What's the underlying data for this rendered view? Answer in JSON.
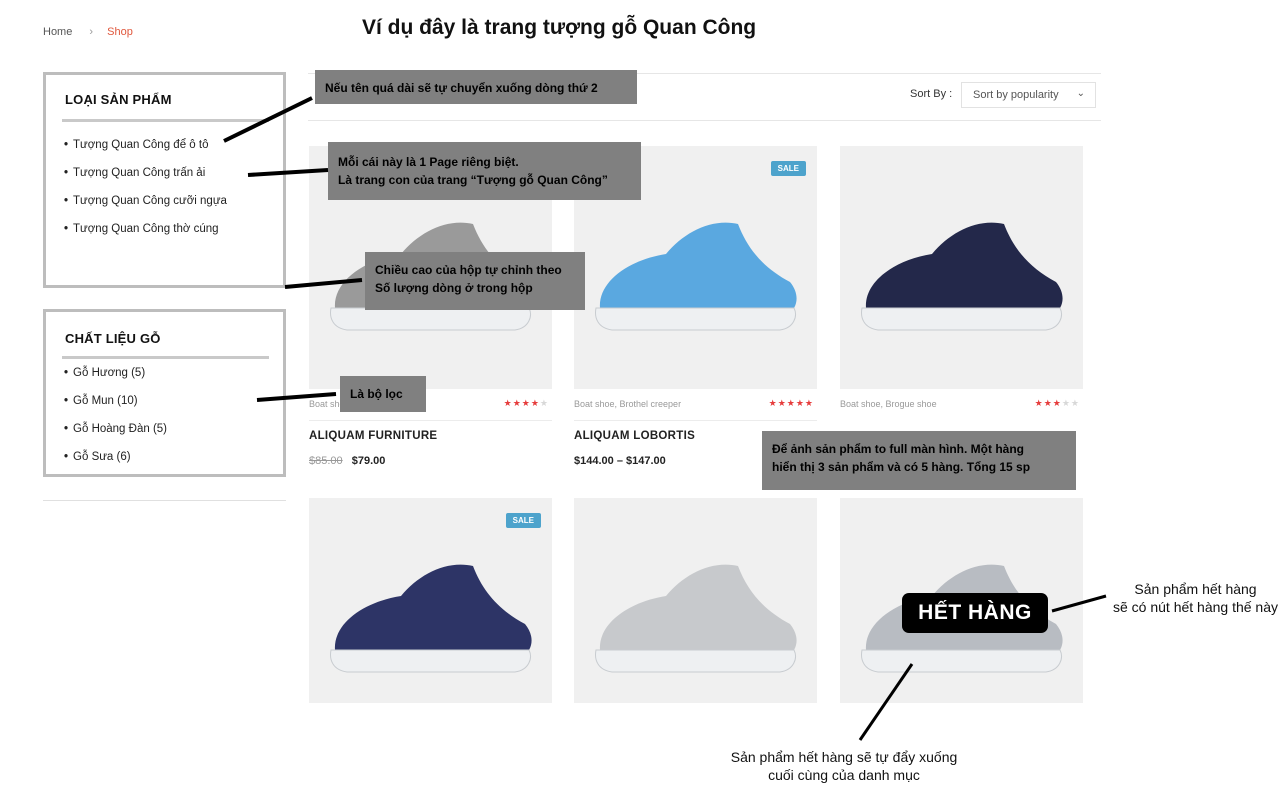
{
  "breadcrumb": {
    "home": "Home",
    "separator": "›",
    "current": "Shop"
  },
  "heading": "Ví dụ đây là trang tượng gỗ Quan Công",
  "sidebar": {
    "categories": {
      "title": "LOẠI SẢN PHẨM",
      "items": [
        "Tượng Quan Công để ô tô",
        "Tượng Quan Công trấn ải",
        "Tượng Quan Công cưỡi ngựa",
        "Tượng Quan Công thờ cúng"
      ]
    },
    "materials": {
      "title": "CHẤT LIỆU GỖ",
      "items": [
        "Gỗ Hương (5)",
        "Gỗ Mun (10)",
        "Gỗ Hoàng Đàn (5)",
        "Gỗ Sưa (6)"
      ]
    }
  },
  "toolbar": {
    "sort_label": "Sort By :",
    "sort_value": "Sort by popularity",
    "chevron_icon": "chevron-down-icon"
  },
  "products": [
    {
      "categories": "Boat shoe,",
      "rating": 4,
      "name": "ALIQUAM FURNITURE",
      "old_price": "$85.00",
      "price": "$79.00",
      "sale": "",
      "shoe_color": "#9a9a9a"
    },
    {
      "categories": "Boat shoe, Brothel creeper",
      "rating": 5,
      "name": "ALIQUAM LOBORTIS",
      "old_price": "",
      "price": "$144.00 – $147.00",
      "sale": "SALE",
      "shoe_color": "#5aa8e0"
    },
    {
      "categories": "Boat shoe, Brogue shoe",
      "rating": 3,
      "name": "",
      "old_price": "",
      "price": "",
      "sale": "",
      "shoe_color": "#23284a"
    },
    {
      "categories": "",
      "rating": 0,
      "name": "",
      "old_price": "",
      "price": "",
      "sale": "SALE",
      "shoe_color": "#2d3466"
    },
    {
      "categories": "",
      "rating": 0,
      "name": "",
      "old_price": "",
      "price": "",
      "sale": "",
      "shoe_color": "#c7c9cc"
    },
    {
      "categories": "",
      "rating": 0,
      "name": "",
      "old_price": "",
      "price": "",
      "sale": "",
      "shoe_color": "#b8bcc2"
    }
  ],
  "out_of_stock_label": "HẾT HÀNG",
  "annotations": {
    "note1": "Nếu tên quá dài sẽ tự chuyển xuống dòng thứ 2",
    "note2_line1": "Mỗi cái này là 1 Page riêng biệt.",
    "note2_line2": "Là trang con của trang “Tượng gỗ Quan Công”",
    "note3_line1": "Chiều cao của hộp tự chỉnh theo",
    "note3_line2": "Số lượng dòng ở trong hộp",
    "note4": "Là bộ lọc",
    "note5_line1": "Để ảnh sản phẩm to full màn hình. Một hàng",
    "note5_line2": "hiển thị 3 sản phẩm và có 5 hàng. Tổng 15 sp",
    "oos_note_line1": "Sản phẩm hết hàng",
    "oos_note_line2": "sẽ có nút hết hàng thế này",
    "bottom_note_line1": "Sản phẩm hết hàng sẽ tự đẩy xuống",
    "bottom_note_line2": "cuối cùng của danh mục"
  },
  "colors": {
    "accent": "#e0573c",
    "sale_badge": "#4da3cc",
    "stars": "#e63c3c",
    "note_bg": "#808080"
  }
}
